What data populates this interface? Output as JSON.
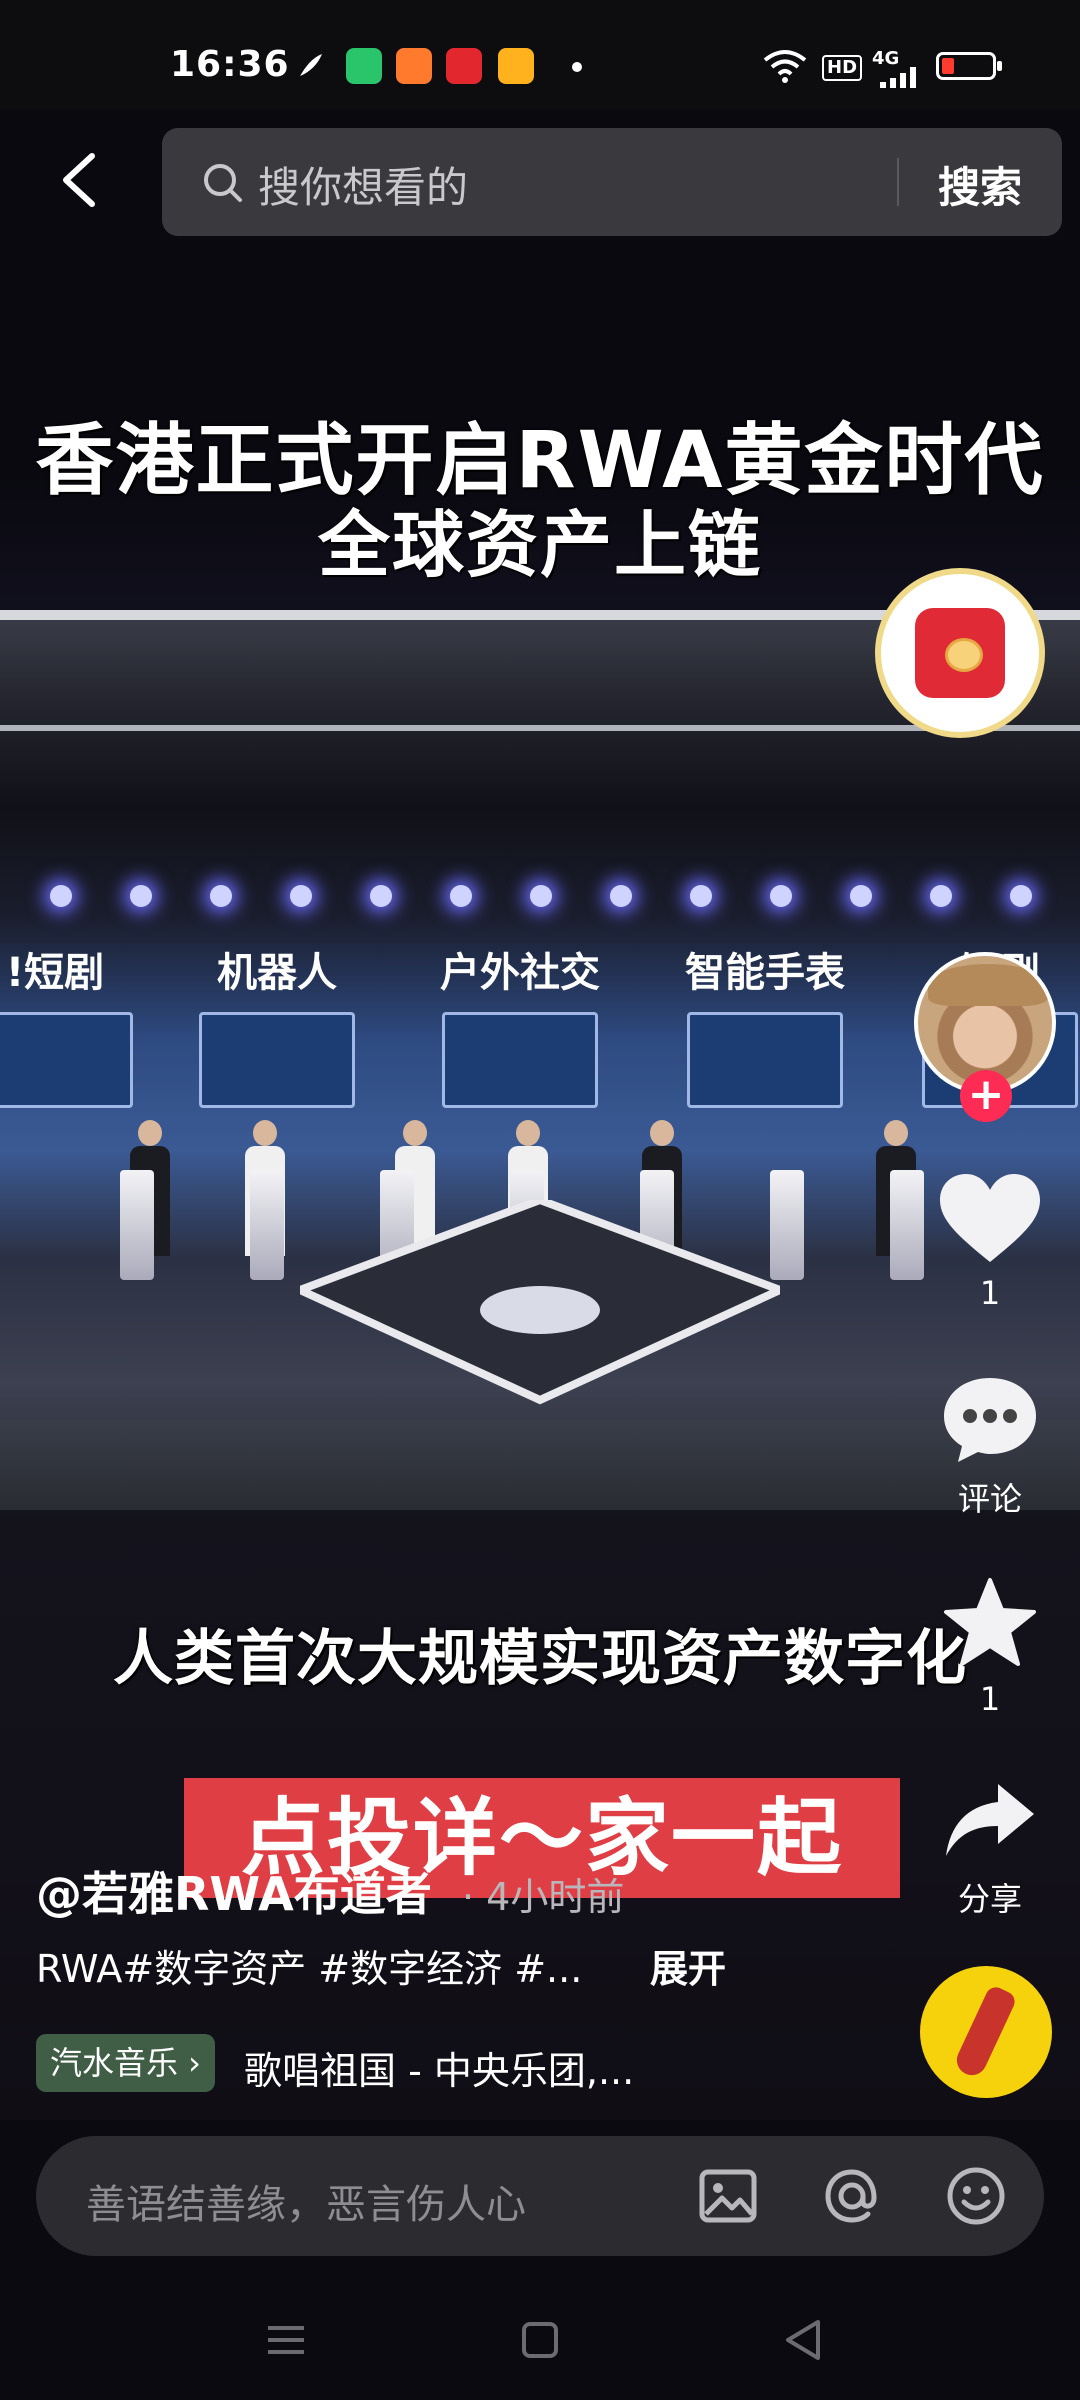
{
  "status_bar": {
    "time": "16:36",
    "network": "4G",
    "hd": "HD",
    "battery_level": 0.2,
    "battery_color": "#ff3b30",
    "notification_icons": [
      "app-icon-green",
      "app-icon-orange",
      "toutiao-icon",
      "game-icon"
    ]
  },
  "search": {
    "placeholder": "搜你想看的",
    "button": "搜索"
  },
  "video": {
    "caption_top_line1": "香港正式开启RWA黄金时代",
    "caption_top_line2": "全球资产上链",
    "stage_labels": [
      "!短剧",
      "机器人",
      "户外社交",
      "智能手表",
      "短剧"
    ],
    "caption_mid": "人类首次大规模实现资产数字化",
    "banner": "点投详～家一起",
    "banner_color": "#e03e45"
  },
  "rail": {
    "like_count": "1",
    "comment_label": "评论",
    "favorite_count": "1",
    "share_label": "分享",
    "follow_symbol": "+",
    "accent": "#fe2c55"
  },
  "post": {
    "author": "@若雅RWA布道者",
    "time_ago": "· 4小时前",
    "description": "RWA#数字资产 #数字经济 #...",
    "expand": "展开",
    "music_tag": "汽水音乐 ›",
    "song": "歌唱祖国 - 中央乐团,..."
  },
  "comment_bar": {
    "placeholder": "善语结善缘，恶言伤人心"
  }
}
